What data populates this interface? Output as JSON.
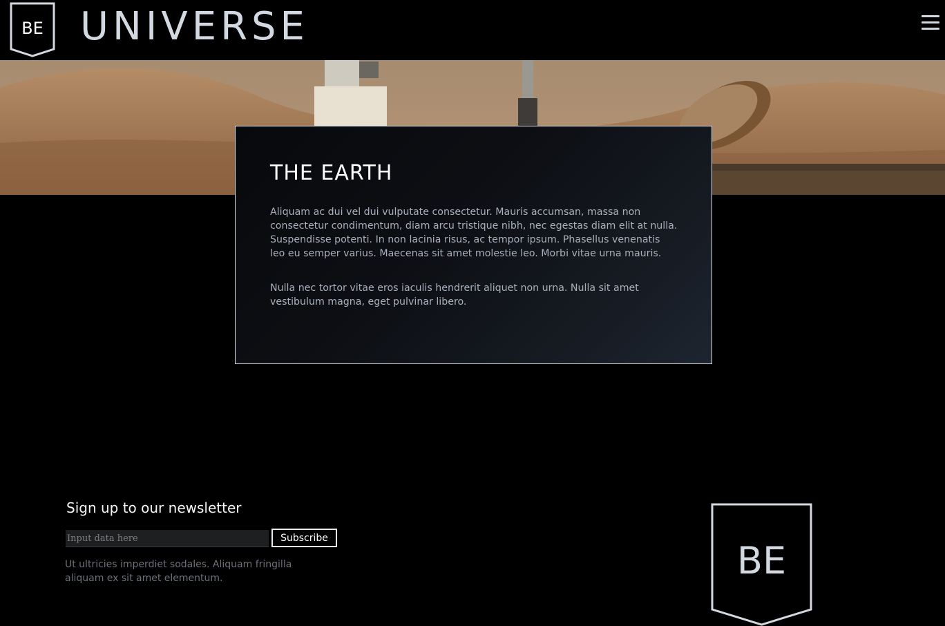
{
  "header": {
    "logo_text": "BE",
    "brand": "UNIVERSE"
  },
  "card": {
    "title": "THE EARTH",
    "paragraphs": [
      "Aliquam ac dui vel dui vulputate consectetur. Mauris accumsan, massa non consectetur condimentum, diam arcu tristique nibh, nec egestas diam elit at nulla. Suspendisse potenti. In non lacinia risus, ac tempor ipsum. Phasellus venenatis leo eu semper varius. Maecenas sit amet molestie leo. Morbi vitae urna mauris.",
      "Nulla nec tortor vitae eros iaculis hendrerit aliquet non urna. Nulla sit amet vestibulum magna, eget pulvinar libero."
    ]
  },
  "newsletter": {
    "title": "Sign up to our newsletter",
    "input_placeholder": "Input data here",
    "button_label": "Subscribe",
    "text": "Ut ultricies imperdiet sodales. Aliquam fringilla aliquam ex sit amet elementum."
  },
  "footer": {
    "logo_text": "BE"
  },
  "colors": {
    "background": "#000000",
    "accent": "#d3d9e0",
    "card_bg": "#0d0f14"
  }
}
